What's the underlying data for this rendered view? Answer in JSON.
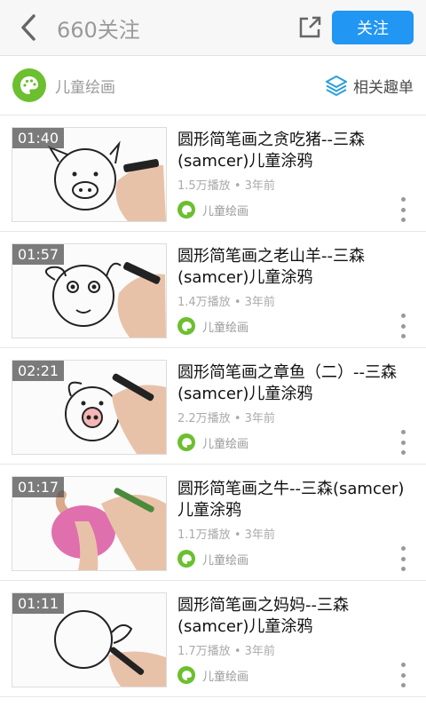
{
  "header": {
    "title": "660关注",
    "follow_label": "关注"
  },
  "channel": {
    "name": "儿童绘画",
    "related_label": "相关趣单"
  },
  "videos": [
    {
      "duration": "01:40",
      "title": "圆形简笔画之贪吃猪--三森(samcer)儿童涂鸦",
      "plays": "1.5万播放",
      "age": "3年前",
      "uploader": "儿童绘画"
    },
    {
      "duration": "01:57",
      "title": "圆形简笔画之老山羊--三森(samcer)儿童涂鸦",
      "plays": "1.4万播放",
      "age": "3年前",
      "uploader": "儿童绘画"
    },
    {
      "duration": "02:21",
      "title": "圆形简笔画之章鱼（二）--三森(samcer)儿童涂鸦",
      "plays": "2.2万播放",
      "age": "3年前",
      "uploader": "儿童绘画"
    },
    {
      "duration": "01:17",
      "title": "圆形简笔画之牛--三森(samcer)儿童涂鸦",
      "plays": "1.1万播放",
      "age": "3年前",
      "uploader": "儿童绘画"
    },
    {
      "duration": "01:11",
      "title": "圆形简笔画之妈妈--三森(samcer)儿童涂鸦",
      "plays": "1.7万播放",
      "age": "3年前",
      "uploader": "儿童绘画"
    }
  ],
  "meta_separator": "•",
  "colors": {
    "accent": "#2196f3",
    "channel_green": "#6cbf2f"
  },
  "icons": {
    "back": "chevron-left-icon",
    "share": "share-icon",
    "palette": "palette-icon",
    "layers": "layers-icon",
    "more": "more-vertical-icon"
  }
}
